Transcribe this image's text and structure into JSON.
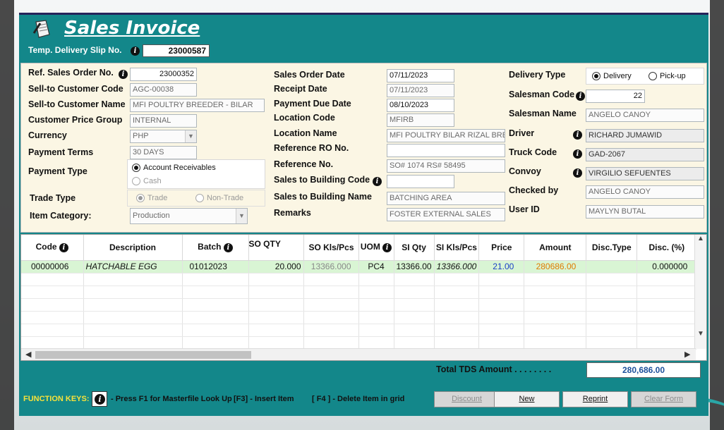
{
  "window": {
    "title": "Sales Invoice"
  },
  "slip": {
    "label": "Temp. Delivery Slip No.",
    "value": "23000587"
  },
  "header": {
    "ref_sales_order": {
      "label": "Ref. Sales Order No.",
      "value": "23000352"
    },
    "sell_to_code": {
      "label": "Sell-to Customer Code",
      "value": "AGC-00038"
    },
    "sell_to_name": {
      "label": "Sell-to Customer Name",
      "value": "MFI POULTRY BREEDER - BILAR"
    },
    "price_group": {
      "label": "Customer Price Group",
      "value": "INTERNAL"
    },
    "currency": {
      "label": "Currency",
      "value": "PHP"
    },
    "payment_terms": {
      "label": "Payment Terms",
      "value": "30 DAYS"
    },
    "payment_type": {
      "label": "Payment Type",
      "options": [
        "Account Receivables",
        "Cash"
      ],
      "selected": "Account Receivables"
    },
    "trade_type": {
      "label": "Trade Type",
      "options": [
        "Trade",
        "Non-Trade"
      ],
      "selected": "Trade"
    },
    "item_category": {
      "label": "Item Category:",
      "value": "Production"
    },
    "so_date": {
      "label": "Sales Order Date",
      "value": "07/11/2023"
    },
    "receipt_date": {
      "label": "Receipt Date",
      "value": "07/11/2023"
    },
    "payment_due": {
      "label": "Payment Due Date",
      "value": "08/10/2023"
    },
    "location_code": {
      "label": "Location Code",
      "value": "MFIRB"
    },
    "location_name": {
      "label": "Location Name",
      "value": "MFI POULTRY BILAR RIZAL BREEI"
    },
    "reference_ro": {
      "label": "Reference RO No.",
      "value": ""
    },
    "reference_no": {
      "label": "Reference No.",
      "value": "SO# 1074 RS# 58495"
    },
    "bldg_code": {
      "label": "Sales to Building Code",
      "value": ""
    },
    "bldg_name": {
      "label": "Sales to Building Name",
      "value": "BATCHING AREA"
    },
    "remarks": {
      "label": "Remarks",
      "value": "FOSTER EXTERNAL SALES"
    },
    "delivery_type": {
      "label": "Delivery Type",
      "options": [
        "Delivery",
        "Pick-up"
      ],
      "selected": "Delivery"
    },
    "salesman_code": {
      "label": "Salesman Code",
      "value": "22"
    },
    "salesman_name": {
      "label": "Salesman Name",
      "value": "ANGELO CANOY"
    },
    "driver": {
      "label": "Driver",
      "value": "RICHARD JUMAWID"
    },
    "truck_code": {
      "label": "Truck Code",
      "value": "GAD-2067"
    },
    "convoy": {
      "label": "Convoy",
      "value": "VIRGILIO SEFUENTES"
    },
    "checked_by": {
      "label": "Checked by",
      "value": "ANGELO CANOY"
    },
    "user_id": {
      "label": "User ID",
      "value": "MAYLYN BUTAL"
    }
  },
  "grid": {
    "columns": [
      "Code",
      "Description",
      "Batch",
      "SO QTY",
      "SO Kls/Pcs",
      "UOM",
      "SI Qty",
      "SI Kls/Pcs",
      "Price",
      "Amount",
      "Disc.Type",
      "Disc. (%)"
    ],
    "rows": [
      {
        "code": "00000006",
        "description": "HATCHABLE EGG",
        "batch": "01012023",
        "so_qty": "20.000",
        "so_kls": "13366.000",
        "uom": "PC4",
        "si_qty": "13366.00",
        "si_kls": "13366.000",
        "price": "21.00",
        "amount": "280686.00",
        "disc_type": "",
        "disc_pct": "0.000000"
      }
    ]
  },
  "totals": {
    "label": "Total TDS Amount . . . . . . . .",
    "value": "280,686.00"
  },
  "function_keys": {
    "label": "FUNCTION KEYS:",
    "f1": "- Press F1 for Masterfile Look Up",
    "f3": "[F3] - Insert Item",
    "f4": "[ F4 ] - Delete Item in grid"
  },
  "buttons": {
    "discount": "Discount",
    "new": "New",
    "reprint": "Reprint",
    "clear_form": "Clear Form"
  },
  "colors": {
    "window": "#13878a",
    "panel": "#fbf6e4",
    "selected_row": "#d9f5d4",
    "amount": "#e07b00",
    "price": "#1a3fc7",
    "fk_label": "#f7e23a"
  }
}
